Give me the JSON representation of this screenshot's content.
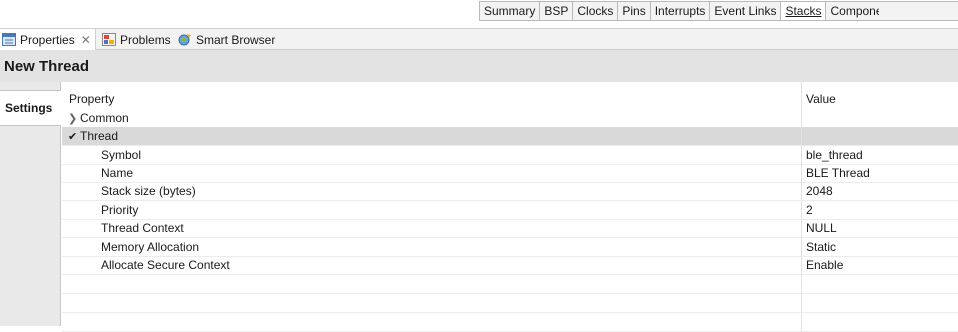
{
  "top_tabs": [
    {
      "label": "Summary",
      "active": false
    },
    {
      "label": "BSP",
      "active": false
    },
    {
      "label": "Clocks",
      "active": false
    },
    {
      "label": "Pins",
      "active": false
    },
    {
      "label": "Interrupts",
      "active": false
    },
    {
      "label": "Event Links",
      "active": false
    },
    {
      "label": "Stacks",
      "active": true
    },
    {
      "label": "Components",
      "active": false
    }
  ],
  "view_tabs": {
    "properties": {
      "label": "Properties",
      "icon": "properties-view-icon"
    },
    "problems": {
      "label": "Problems",
      "icon": "problems-icon"
    },
    "smart_browser": {
      "label": "Smart Browser",
      "icon": "smart-browser-icon"
    },
    "close_glyph": "✕"
  },
  "page_title": "New Thread",
  "side_tab": "Settings",
  "table": {
    "header_property": "Property",
    "header_value": "Value",
    "groups": [
      {
        "label": "Common",
        "expanded": false
      },
      {
        "label": "Thread",
        "expanded": true
      }
    ],
    "rows": [
      {
        "property": "Symbol",
        "value": "ble_thread"
      },
      {
        "property": "Name",
        "value": "BLE Thread"
      },
      {
        "property": "Stack size (bytes)",
        "value": "2048"
      },
      {
        "property": "Priority",
        "value": "2"
      },
      {
        "property": "Thread Context",
        "value": "NULL"
      },
      {
        "property": "Memory Allocation",
        "value": "Static"
      },
      {
        "property": "Allocate Secure Context",
        "value": "Enable"
      }
    ]
  },
  "colors": {
    "title_band": "#e3e3e3",
    "selected_group": "#d9d9d9",
    "tab_strip": "#f2f2f2"
  }
}
